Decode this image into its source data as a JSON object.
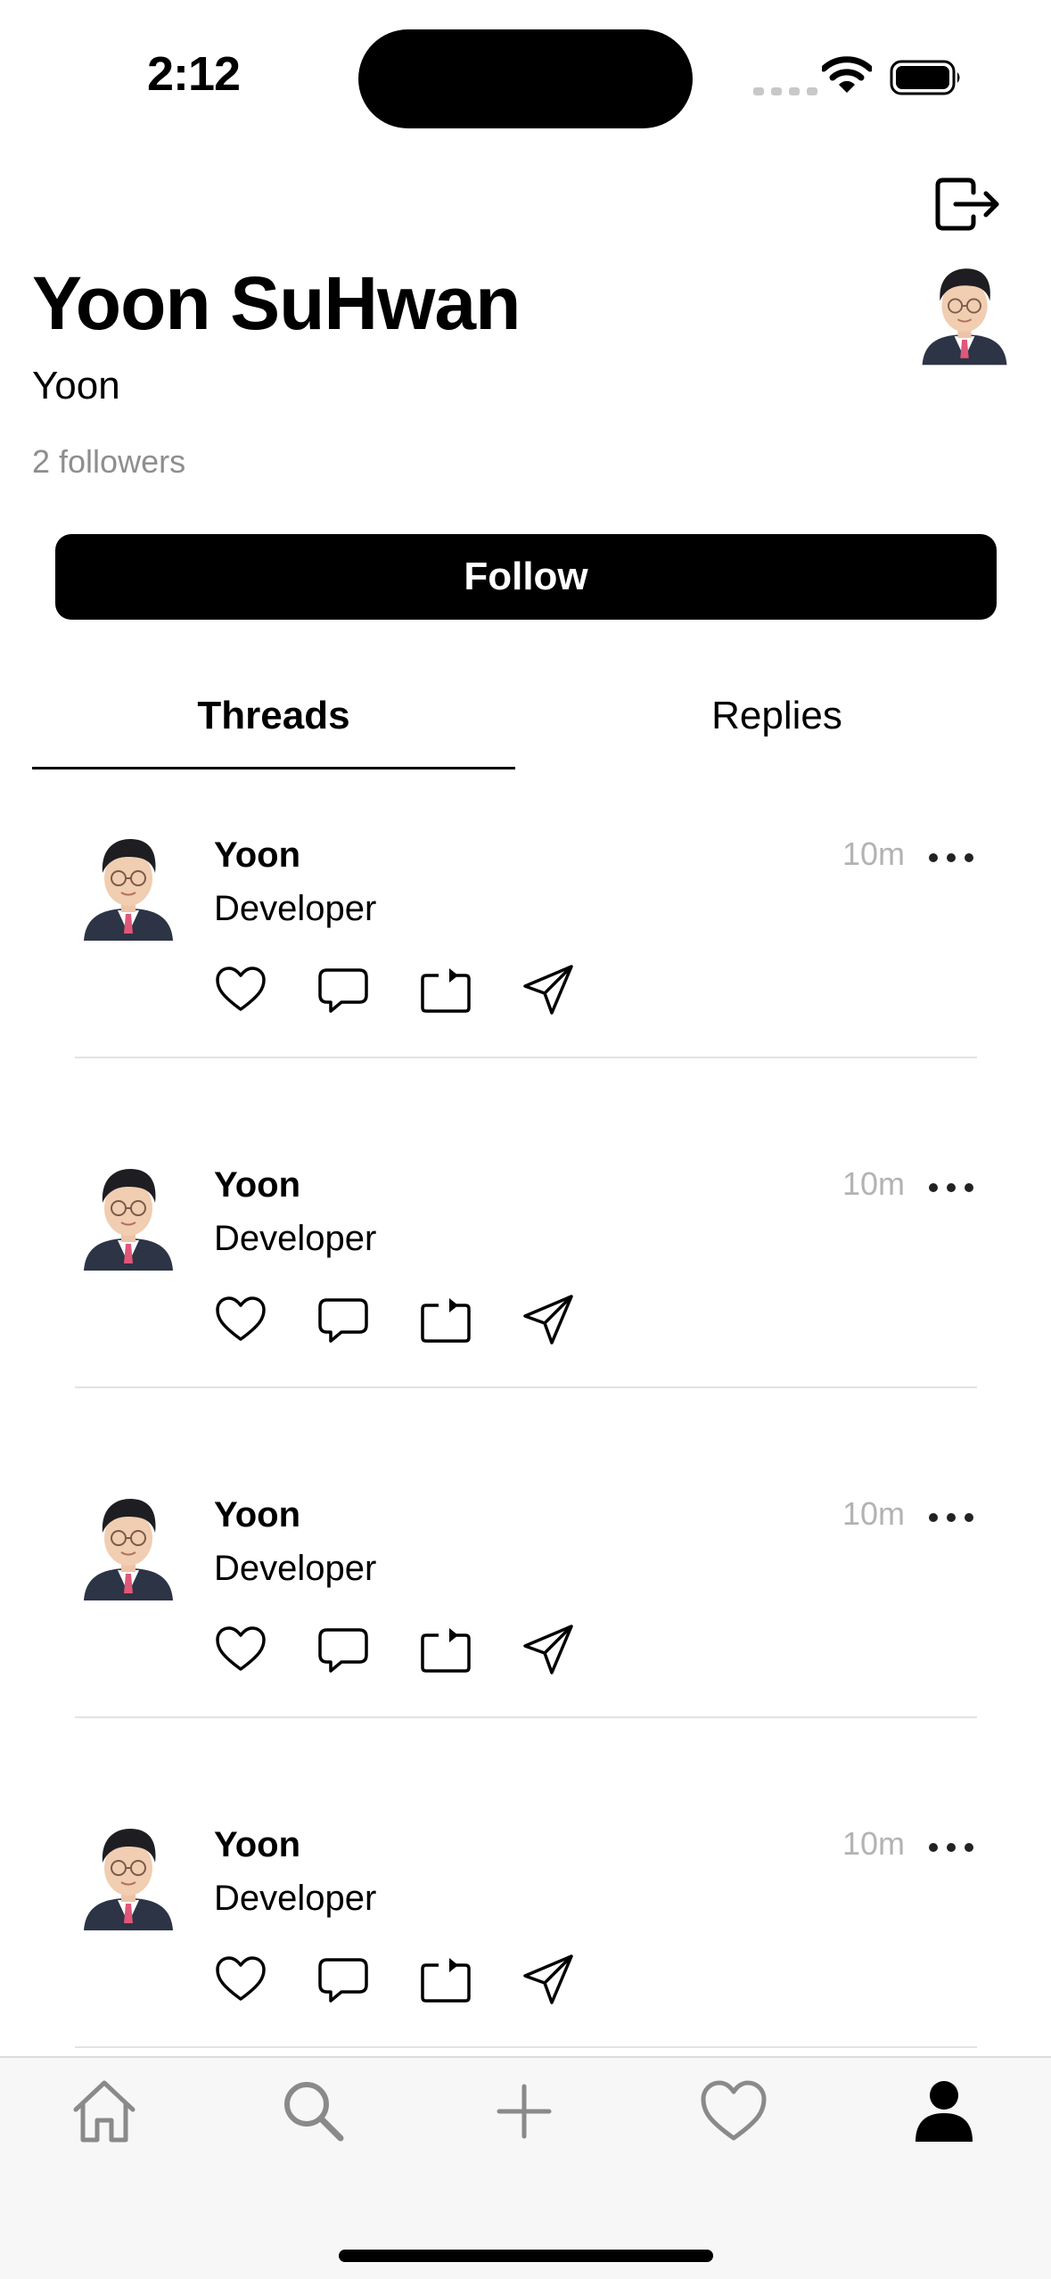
{
  "status_bar": {
    "time": "2:12"
  },
  "profile": {
    "name": "Yoon SuHwan",
    "username": "Yoon",
    "followers": "2 followers",
    "follow_label": "Follow"
  },
  "tabs": [
    {
      "label": "Threads",
      "active": true
    },
    {
      "label": "Replies",
      "active": false
    }
  ],
  "threads": [
    {
      "author": "Yoon",
      "content": "Developer",
      "time": "10m"
    },
    {
      "author": "Yoon",
      "content": "Developer",
      "time": "10m"
    },
    {
      "author": "Yoon",
      "content": "Developer",
      "time": "10m"
    },
    {
      "author": "Yoon",
      "content": "Developer",
      "time": "10m"
    }
  ],
  "thread_actions": [
    "heart-icon",
    "comment-icon",
    "repost-icon",
    "send-icon"
  ],
  "tab_bar": [
    "home-icon",
    "search-icon",
    "plus-icon",
    "heart-icon",
    "profile-icon"
  ],
  "colors": {
    "accent": "#000000",
    "muted": "#8e8e8e",
    "time": "#b3b3b3"
  }
}
